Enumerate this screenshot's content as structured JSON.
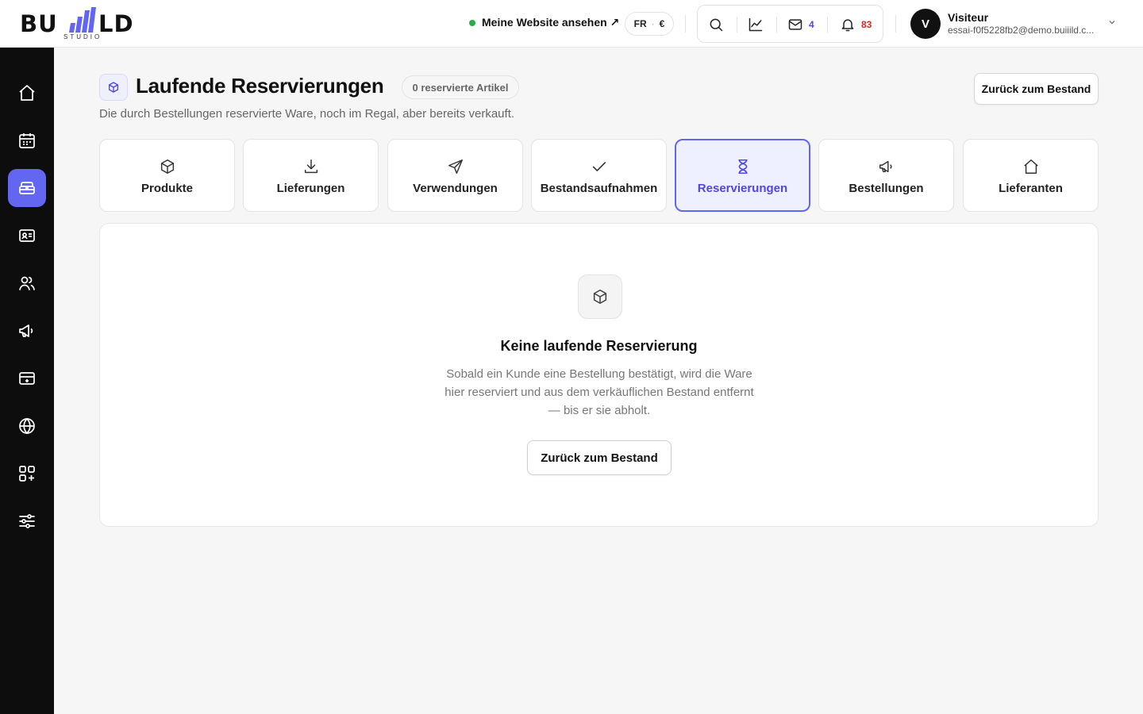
{
  "brand": {
    "logo_left": "BU",
    "logo_right": "LD",
    "logo_sub": "STUDIO",
    "accent": "#6366f1",
    "accent_dark": "#4f46e5"
  },
  "header": {
    "site_link": "Meine Website ansehen ↗",
    "site_status_color": "#22b04b",
    "lang": "FR",
    "currency": "€",
    "tools": [
      {
        "icon": "search-icon"
      },
      {
        "icon": "chart-icon"
      },
      {
        "icon": "mail-icon",
        "count": "4"
      },
      {
        "icon": "bell-icon",
        "count": "83"
      }
    ],
    "user": {
      "initial": "V",
      "name": "Visiteur",
      "email": "essai-f0f5228fb2@demo.buiiild.c..."
    }
  },
  "sidebar": {
    "items": [
      {
        "icon": "home-icon"
      },
      {
        "icon": "calendar-icon"
      },
      {
        "icon": "inventory-icon",
        "active": true
      },
      {
        "icon": "contact-card-icon"
      },
      {
        "icon": "users-icon"
      },
      {
        "icon": "megaphone-icon"
      },
      {
        "icon": "payment-card-icon"
      },
      {
        "icon": "globe-icon"
      },
      {
        "icon": "apps-add-icon"
      },
      {
        "icon": "sliders-icon"
      }
    ]
  },
  "page": {
    "title": "Laufende Reservierungen",
    "badge": "0 reservierte Artikel",
    "subtitle": "Die durch Bestellungen reservierte Ware, noch im Regal, aber bereits verkauft.",
    "back_button": "Zurück zum Bestand"
  },
  "tabs": [
    {
      "label": "Produkte",
      "icon": "box-icon"
    },
    {
      "label": "Lieferungen",
      "icon": "download-icon"
    },
    {
      "label": "Verwendungen",
      "icon": "send-icon"
    },
    {
      "label": "Bestandsaufnahmen",
      "icon": "check-icon"
    },
    {
      "label": "Reservierungen",
      "icon": "hourglass-icon",
      "active": true
    },
    {
      "label": "Bestellungen",
      "icon": "megaphone-icon"
    },
    {
      "label": "Lieferanten",
      "icon": "home-icon"
    }
  ],
  "empty_state": {
    "icon": "box-icon",
    "title": "Keine laufende Reservierung",
    "text": "Sobald ein Kunde eine Bestellung bestätigt, wird die Ware hier reserviert und aus dem verkäuflichen Bestand entfernt — bis er sie abholt.",
    "button": "Zurück zum Bestand"
  }
}
